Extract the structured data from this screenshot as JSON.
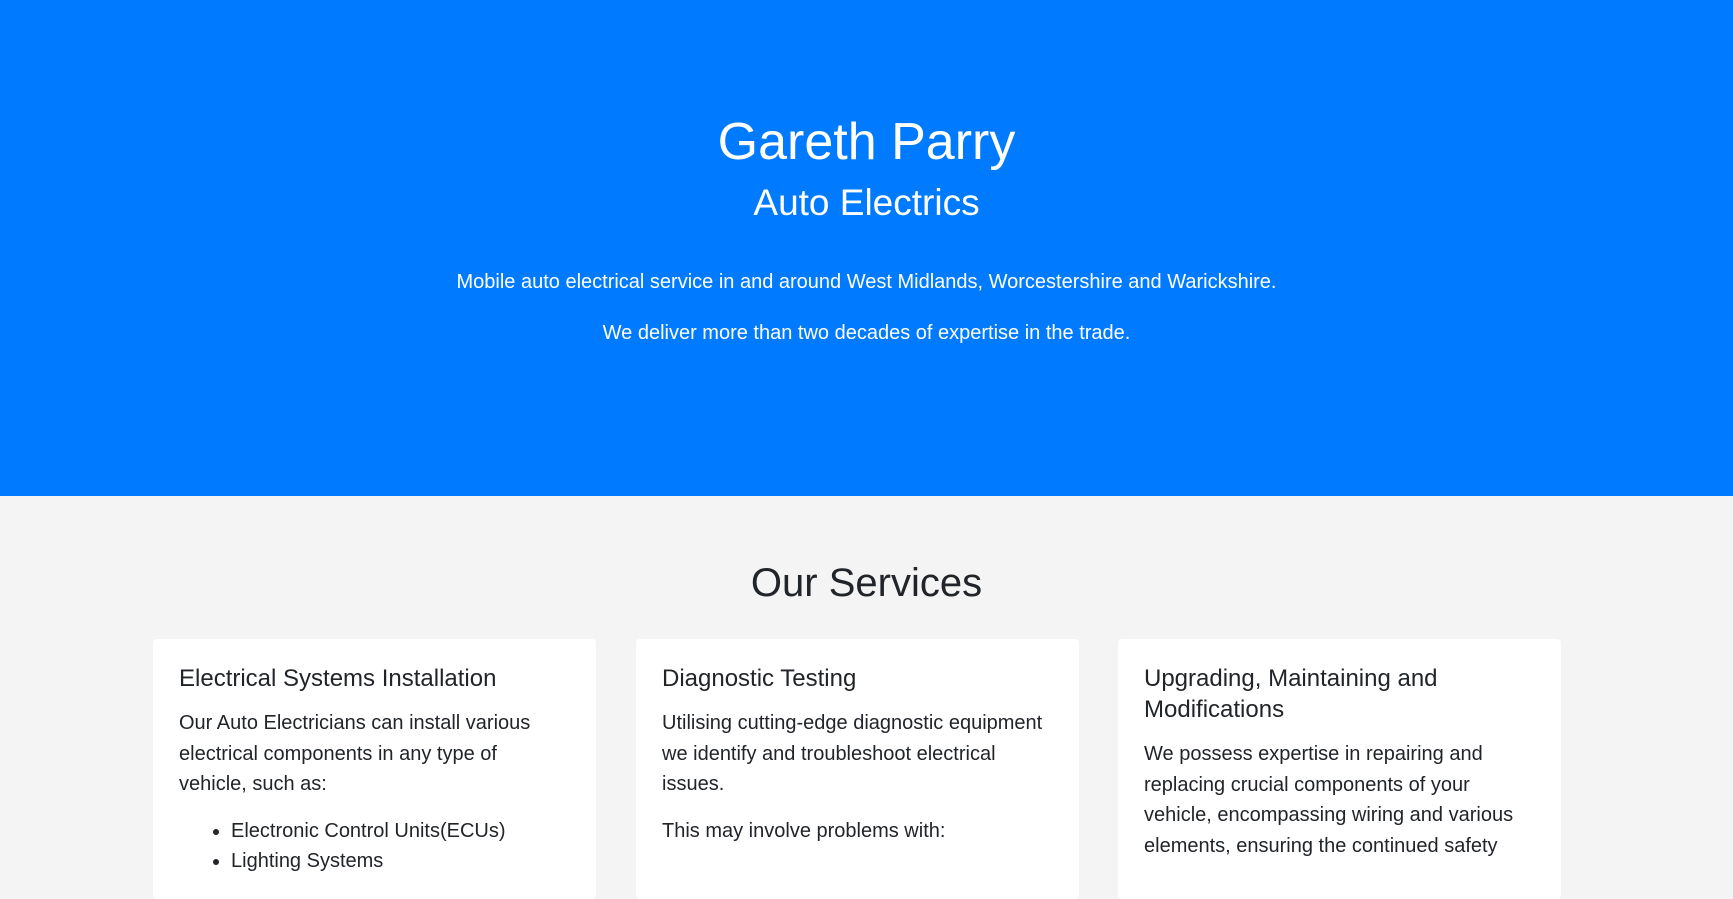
{
  "hero": {
    "title": "Gareth Parry",
    "subtitle": "Auto Electrics",
    "line1": "Mobile auto electrical service in and around West Midlands, Worcestershire and Warickshire.",
    "line2": "We deliver more than two decades of expertise in the trade.",
    "background_color": "#007bff"
  },
  "services": {
    "title": "Our Services",
    "cards": [
      {
        "title": "Electrical Systems Installation",
        "text": "Our Auto Electricians can install various electrical components in any type of vehicle, such as:",
        "items": [
          "Electronic Control Units(ECUs)",
          "Lighting Systems"
        ]
      },
      {
        "title": "Diagnostic Testing",
        "text": "Utilising cutting-edge diagnostic equipment we identify and troubleshoot electrical issues.",
        "text2": "This may involve problems with:"
      },
      {
        "title": "Upgrading, Maintaining and Modifications",
        "text": "We possess expertise in repairing and replacing crucial components of your vehicle, encompassing wiring and various elements, ensuring the continued safety"
      }
    ]
  }
}
